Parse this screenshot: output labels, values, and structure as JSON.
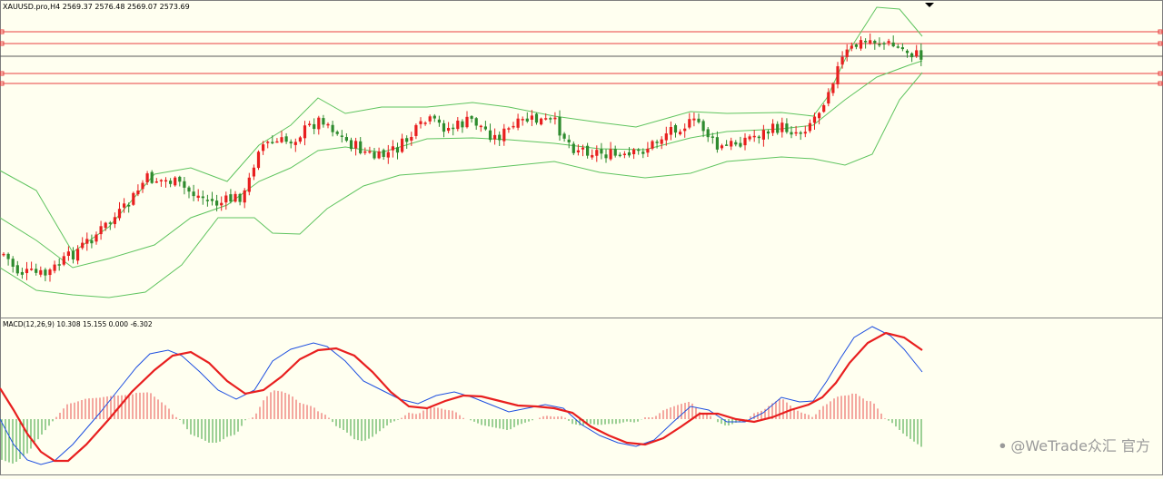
{
  "colors": {
    "background": "#fffff0",
    "frame": "#7f7f7f",
    "up_candle": "#e81f1f",
    "down_candle": "#2e8b2e",
    "bollinger": "#5fc45f",
    "level_lines": "#e84040",
    "current_price_line": "#5a5a5a",
    "macd_line": "#1e4fe0",
    "signal_line": "#e81f1f",
    "hist_up": "#e85050",
    "hist_down": "#3aa03a",
    "watermark": "#9a9a9a"
  },
  "main_panel": {
    "header": "XAUUSD.pro,H4  2569.37 2576.48 2569.07 2573.69"
  },
  "macd_panel": {
    "header": "MACD(12,26,9) 10.308 15.155 0.000 -6.302"
  },
  "watermark": {
    "text": "@WeTrade众汇 官方"
  },
  "chart_data": [
    {
      "type": "candlestick",
      "symbol": "XAUUSD.pro",
      "timeframe": "H4",
      "ohlc": [
        2569.37,
        2576.48,
        2569.07,
        2573.69
      ],
      "indicators": [
        "Bollinger Bands"
      ],
      "horizontal_levels": 5,
      "axis_labels": false,
      "grid": false,
      "trend": "uptrend with consolidation, strong breakout near the end"
    },
    {
      "type": "line+histogram",
      "indicator": "MACD",
      "params": [
        12,
        26,
        9
      ],
      "values": [
        10.308,
        15.155,
        0.0,
        -6.302
      ],
      "series": [
        {
          "name": "MACD"
        },
        {
          "name": "Signal"
        }
      ]
    }
  ]
}
